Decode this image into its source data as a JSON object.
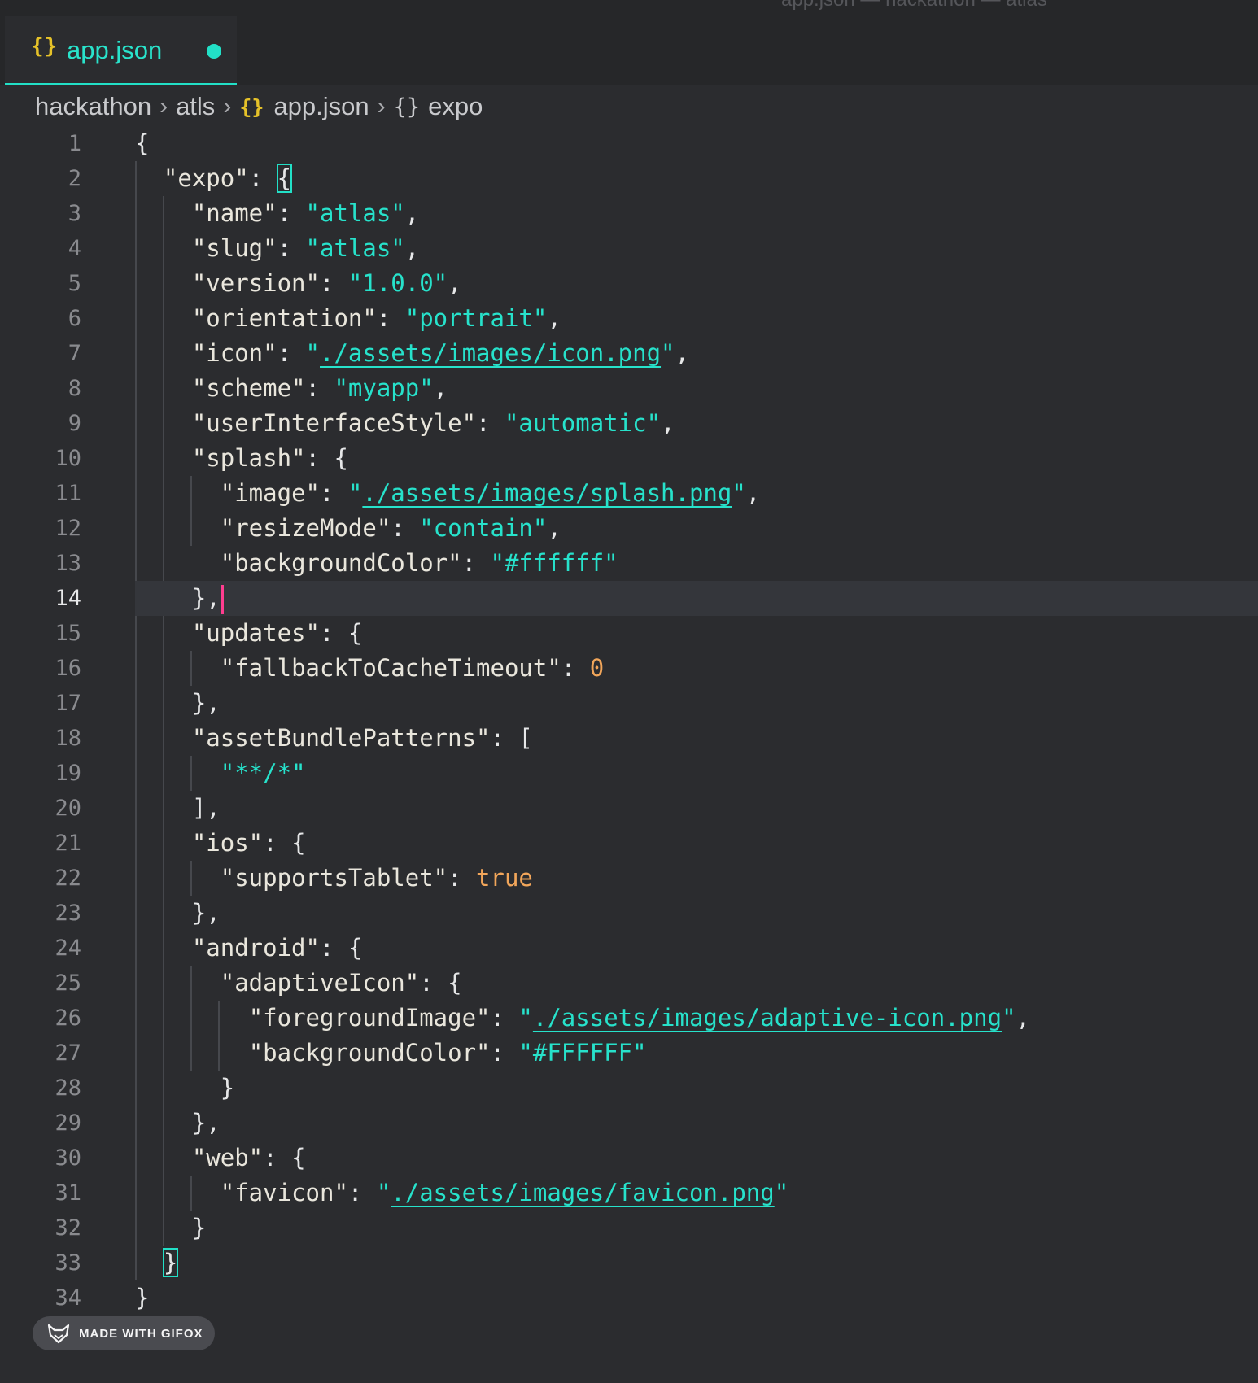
{
  "window": {
    "title_fragment": "app.json — hackathon — atlas"
  },
  "tab": {
    "icon": "json-braces-icon",
    "label": "app.json",
    "dirty": true
  },
  "breadcrumb": {
    "items": [
      "hackathon",
      "atls",
      "app.json",
      "expo"
    ]
  },
  "editor": {
    "current_line": 14,
    "lines": [
      {
        "n": "1"
      },
      {
        "n": "2"
      },
      {
        "n": "3"
      },
      {
        "n": "4"
      },
      {
        "n": "5"
      },
      {
        "n": "6"
      },
      {
        "n": "7"
      },
      {
        "n": "8"
      },
      {
        "n": "9"
      },
      {
        "n": "10"
      },
      {
        "n": "11"
      },
      {
        "n": "12"
      },
      {
        "n": "13"
      },
      {
        "n": "14"
      },
      {
        "n": "15"
      },
      {
        "n": "16"
      },
      {
        "n": "17"
      },
      {
        "n": "18"
      },
      {
        "n": "19"
      },
      {
        "n": "20"
      },
      {
        "n": "21"
      },
      {
        "n": "22"
      },
      {
        "n": "23"
      },
      {
        "n": "24"
      },
      {
        "n": "25"
      },
      {
        "n": "26"
      },
      {
        "n": "27"
      },
      {
        "n": "28"
      },
      {
        "n": "29"
      },
      {
        "n": "30"
      },
      {
        "n": "31"
      },
      {
        "n": "32"
      },
      {
        "n": "33"
      },
      {
        "n": "34"
      }
    ],
    "tokens": {
      "l1": "{",
      "l2_key": "\"expo\"",
      "l2_punct": ": ",
      "l2_brace": "{",
      "l3_key": "\"name\"",
      "l3_val": "\"atlas\"",
      "l4_key": "\"slug\"",
      "l4_val": "\"atlas\"",
      "l5_key": "\"version\"",
      "l5_val": "\"1.0.0\"",
      "l6_key": "\"orientation\"",
      "l6_val": "\"portrait\"",
      "l7_key": "\"icon\"",
      "l7_val": "./assets/images/icon.png",
      "l8_key": "\"scheme\"",
      "l8_val": "\"myapp\"",
      "l9_key": "\"userInterfaceStyle\"",
      "l9_val": "\"automatic\"",
      "l10_key": "\"splash\"",
      "l11_key": "\"image\"",
      "l11_val": "./assets/images/splash.png",
      "l12_key": "\"resizeMode\"",
      "l12_val": "\"contain\"",
      "l13_key": "\"backgroundColor\"",
      "l13_val": "\"#ffffff\"",
      "l14": "},",
      "l15_key": "\"updates\"",
      "l16_key": "\"fallbackToCacheTimeout\"",
      "l16_val": "0",
      "l17": "},",
      "l18_key": "\"assetBundlePatterns\"",
      "l18_open": "[",
      "l19_val": "\"**/*\"",
      "l20": "],",
      "l21_key": "\"ios\"",
      "l22_key": "\"supportsTablet\"",
      "l22_val": "true",
      "l23": "},",
      "l24_key": "\"android\"",
      "l25_key": "\"adaptiveIcon\"",
      "l26_key": "\"foregroundImage\"",
      "l26_val": "./assets/images/adaptive-icon.png",
      "l27_key": "\"backgroundColor\"",
      "l27_val": "\"#FFFFFF\"",
      "l28": "}",
      "l29": "},",
      "l30_key": "\"web\"",
      "l31_key": "\"favicon\"",
      "l31_val": "./assets/images/favicon.png",
      "l32": "}",
      "l33": "}",
      "l34": "}"
    }
  },
  "badge": {
    "icon": "fox-icon",
    "label": "MADE WITH GIFOX"
  },
  "colors": {
    "background": "#2b2c2f",
    "accent": "#22e0c7",
    "json_icon": "#e6c229",
    "number": "#f2a65a",
    "cursor": "#ff3d8f"
  }
}
